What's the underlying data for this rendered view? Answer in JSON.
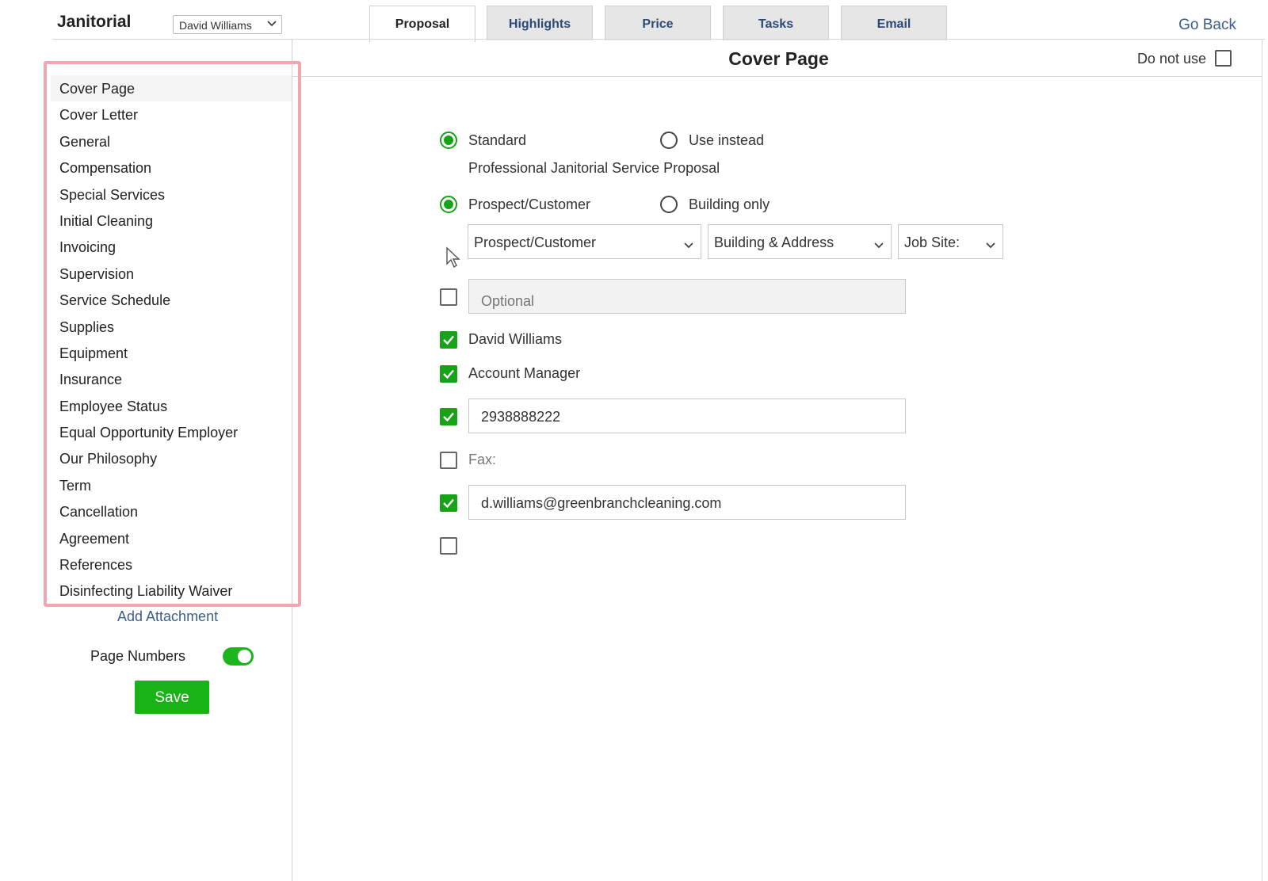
{
  "app": {
    "title": "Janitorial",
    "user_select": "David Williams",
    "go_back": "Go Back"
  },
  "tabs": [
    {
      "label": "Proposal",
      "active": true
    },
    {
      "label": "Highlights",
      "active": false
    },
    {
      "label": "Price",
      "active": false
    },
    {
      "label": "Tasks",
      "active": false
    },
    {
      "label": "Email",
      "active": false
    }
  ],
  "section": {
    "title": "Cover Page",
    "do_not_use_label": "Do not use",
    "do_not_use_checked": false
  },
  "nav": {
    "items": [
      "Cover Page",
      "Cover Letter",
      "General",
      "Compensation",
      "Special Services",
      "Initial Cleaning",
      "Invoicing",
      "Supervision",
      "Service Schedule",
      "Supplies",
      "Equipment",
      "Insurance",
      "Employee Status",
      "Equal Opportunity Employer",
      "Our Philosophy",
      "Term",
      "Cancellation",
      "Agreement",
      "References",
      "Disinfecting Liability Waiver"
    ],
    "active_index": 0,
    "add_attachment": "Add Attachment"
  },
  "footer": {
    "page_numbers_label": "Page Numbers",
    "page_numbers_on": true,
    "save_label": "Save"
  },
  "form": {
    "title_mode": {
      "standard_label": "Standard",
      "use_instead_label": "Use instead",
      "selected": "standard",
      "standard_text": "Professional Janitorial Service Proposal"
    },
    "recipient_mode": {
      "prospect_label": "Prospect/Customer",
      "building_label": "Building only",
      "selected": "prospect"
    },
    "dropdowns": {
      "prospect": "Prospect/Customer",
      "building": "Building & Address",
      "job_site": "Job Site:"
    },
    "optional_field": {
      "checked": false,
      "placeholder": "Optional",
      "value": ""
    },
    "name": {
      "checked": true,
      "label": "David Williams"
    },
    "role": {
      "checked": true,
      "label": "Account Manager"
    },
    "phone": {
      "checked": true,
      "value": "2938888222"
    },
    "fax": {
      "checked": false,
      "label": "Fax:"
    },
    "email": {
      "checked": true,
      "value": "d.williams@greenbranchcleaning.com"
    },
    "extra": {
      "checked": false
    }
  },
  "colors": {
    "accent_green": "#17a317",
    "link_blue": "#3a5e8e",
    "highlight_pink": "#f3a6b0"
  }
}
